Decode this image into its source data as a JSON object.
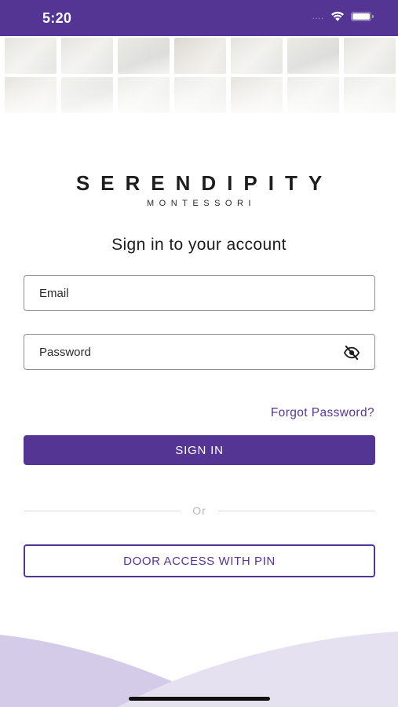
{
  "status_bar": {
    "time": "5:20",
    "icons": [
      "signal-icon",
      "wifi-icon",
      "battery-icon"
    ],
    "signal_dots": "....",
    "background": "#553594"
  },
  "header_photos": {
    "count": 14
  },
  "logo": {
    "main": "SERENDIPITY",
    "sub": "MONTESSORI"
  },
  "heading": "Sign in to your account",
  "form": {
    "email_placeholder": "Email",
    "password_placeholder": "Password",
    "password_toggle_icon": "eye-off-icon",
    "forgot_label": "Forgot Password?",
    "sign_in_label": "SIGN IN",
    "divider_label": "Or",
    "pin_label": "DOOR ACCESS WITH PIN"
  },
  "colors": {
    "accent": "#553594",
    "wave_light": "#e6e1f1",
    "wave_mid": "#d4cbe8",
    "text": "#1c1c1c"
  }
}
